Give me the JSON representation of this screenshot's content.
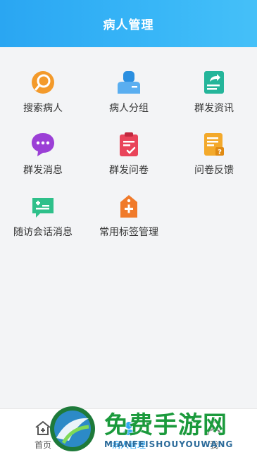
{
  "header": {
    "title": "病人管理"
  },
  "grid": {
    "items": [
      {
        "label": "搜索病人",
        "icon": "search-icon",
        "color": "#f39a2b"
      },
      {
        "label": "病人分组",
        "icon": "group-icon",
        "color": "#2b8fe0"
      },
      {
        "label": "群发资讯",
        "icon": "share-doc-icon",
        "color": "#24b59a"
      },
      {
        "label": "群发消息",
        "icon": "chat-bubble-icon",
        "color": "#9b3fd6"
      },
      {
        "label": "群发问卷",
        "icon": "clipboard-check-icon",
        "color": "#e9445a"
      },
      {
        "label": "问卷反馈",
        "icon": "survey-feedback-icon",
        "color": "#f3a92b"
      },
      {
        "label": "随访会话消息",
        "icon": "followup-chat-icon",
        "color": "#2ec08a"
      },
      {
        "label": "常用标签管理",
        "icon": "tag-add-icon",
        "color": "#f07a2a"
      }
    ]
  },
  "tabbar": {
    "items": [
      {
        "label": "首页",
        "icon": "home-icon",
        "active": false
      },
      {
        "label": "病人管理",
        "icon": "patient-icon",
        "active": true
      },
      {
        "label": "我",
        "icon": "profile-icon",
        "active": false
      }
    ]
  },
  "watermark": {
    "text": "免费手游网",
    "sub": "MIANFEISHOUYOUWANG"
  }
}
